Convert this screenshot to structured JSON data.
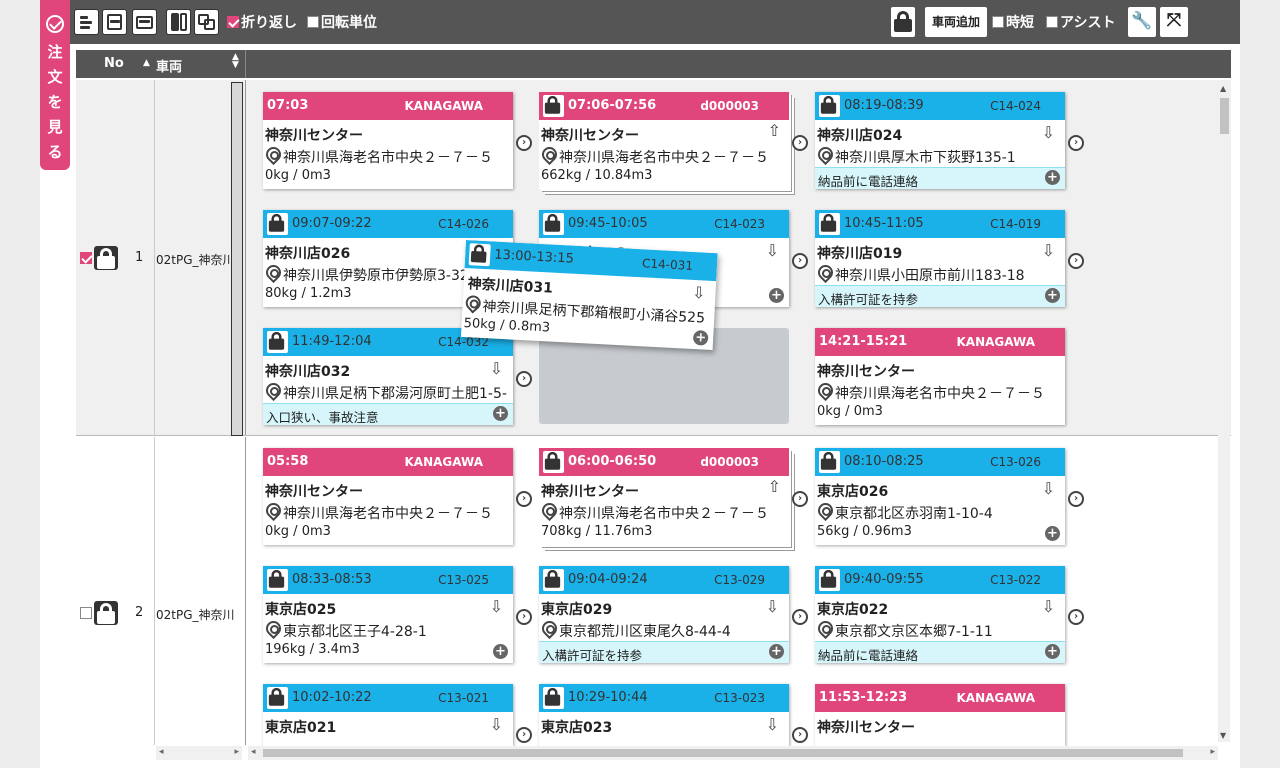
{
  "sidetab": {
    "label": [
      "注",
      "文",
      "を",
      "見",
      "る"
    ]
  },
  "toolbar": {
    "wrap_label": "折り返し",
    "turn_unit_label": "回転単位",
    "add_vehicle_label": "車両追加",
    "short_label": "時短",
    "assist_label": "アシスト"
  },
  "header": {
    "no": "No",
    "vehicle": "車両"
  },
  "rows": [
    {
      "no": "1",
      "name": "02tPG_神奈川"
    },
    {
      "no": "2",
      "name": "02tPG_神奈川"
    }
  ],
  "cards": {
    "r1c1": {
      "time": "07:03",
      "code": "KANAGAWA",
      "name": "神奈川センター",
      "address": "神奈川県海老名市中央２－７－５",
      "weight": "0kg / 0m3"
    },
    "r1c2": {
      "time": "07:06-07:56",
      "code": "d000003",
      "name": "神奈川センター",
      "address": "神奈川県海老名市中央２－７－５",
      "weight": "662kg / 10.84m3"
    },
    "r1c3": {
      "time": "08:19-08:39",
      "code": "C14-024",
      "name": "神奈川店024",
      "address": "神奈川県厚木市下荻野135-1",
      "note": "納品前に電話連絡"
    },
    "r1c4": {
      "time": "09:07-09:22",
      "code": "C14-026",
      "name": "神奈川店026",
      "address": "神奈川県伊勢原市伊勢原3-32",
      "weight": "80kg / 1.2m3"
    },
    "r1c5": {
      "time": "09:45-10:05",
      "code": "C14-023",
      "name": "神奈川店023"
    },
    "r1c6": {
      "time": "10:45-11:05",
      "code": "C14-019",
      "name": "神奈川店019",
      "address": "神奈川県小田原市前川183-18",
      "note": "入構許可証を持参"
    },
    "r1c7": {
      "time": "11:49-12:04",
      "code": "C14-032",
      "name": "神奈川店032",
      "address": "神奈川県足柄下郡湯河原町土肥1-5-",
      "note": "入口狭い、事故注意"
    },
    "r1c8": {
      "time": "14:21-15:21",
      "code": "KANAGAWA",
      "name": "神奈川センター",
      "address": "神奈川県海老名市中央２－７－５",
      "weight": "0kg / 0m3"
    },
    "drag": {
      "time": "13:00-13:15",
      "code": "C14-031",
      "name": "神奈川店031",
      "address": "神奈川県足柄下郡箱根町小涌谷525",
      "weight": "50kg / 0.8m3"
    },
    "r2c1": {
      "time": "05:58",
      "code": "KANAGAWA",
      "name": "神奈川センター",
      "address": "神奈川県海老名市中央２－７－５",
      "weight": "0kg / 0m3"
    },
    "r2c2": {
      "time": "06:00-06:50",
      "code": "d000003",
      "name": "神奈川センター",
      "address": "神奈川県海老名市中央２－７－５",
      "weight": "708kg / 11.76m3"
    },
    "r2c3": {
      "time": "08:10-08:25",
      "code": "C13-026",
      "name": "東京店026",
      "address": "東京都北区赤羽南1-10-4",
      "weight": "56kg / 0.96m3"
    },
    "r2c4": {
      "time": "08:33-08:53",
      "code": "C13-025",
      "name": "東京店025",
      "address": "東京都北区王子4-28-1",
      "weight": "196kg / 3.4m3"
    },
    "r2c5": {
      "time": "09:04-09:24",
      "code": "C13-029",
      "name": "東京店029",
      "address": "東京都荒川区東尾久8-44-4",
      "note": "入構許可証を持参"
    },
    "r2c6": {
      "time": "09:40-09:55",
      "code": "C13-022",
      "name": "東京店022",
      "address": "東京都文京区本郷7-1-11",
      "note": "納品前に電話連絡"
    },
    "r2c7": {
      "time": "10:02-10:22",
      "code": "C13-021",
      "name": "東京店021"
    },
    "r2c8": {
      "time": "10:29-10:44",
      "code": "C13-023",
      "name": "東京店023"
    },
    "r2c9": {
      "time": "11:53-12:23",
      "code": "KANAGAWA",
      "name": "神奈川センター"
    }
  },
  "colors": {
    "pink": "#e0457b",
    "blue": "#1ab0e8",
    "toolbar": "#555555"
  }
}
